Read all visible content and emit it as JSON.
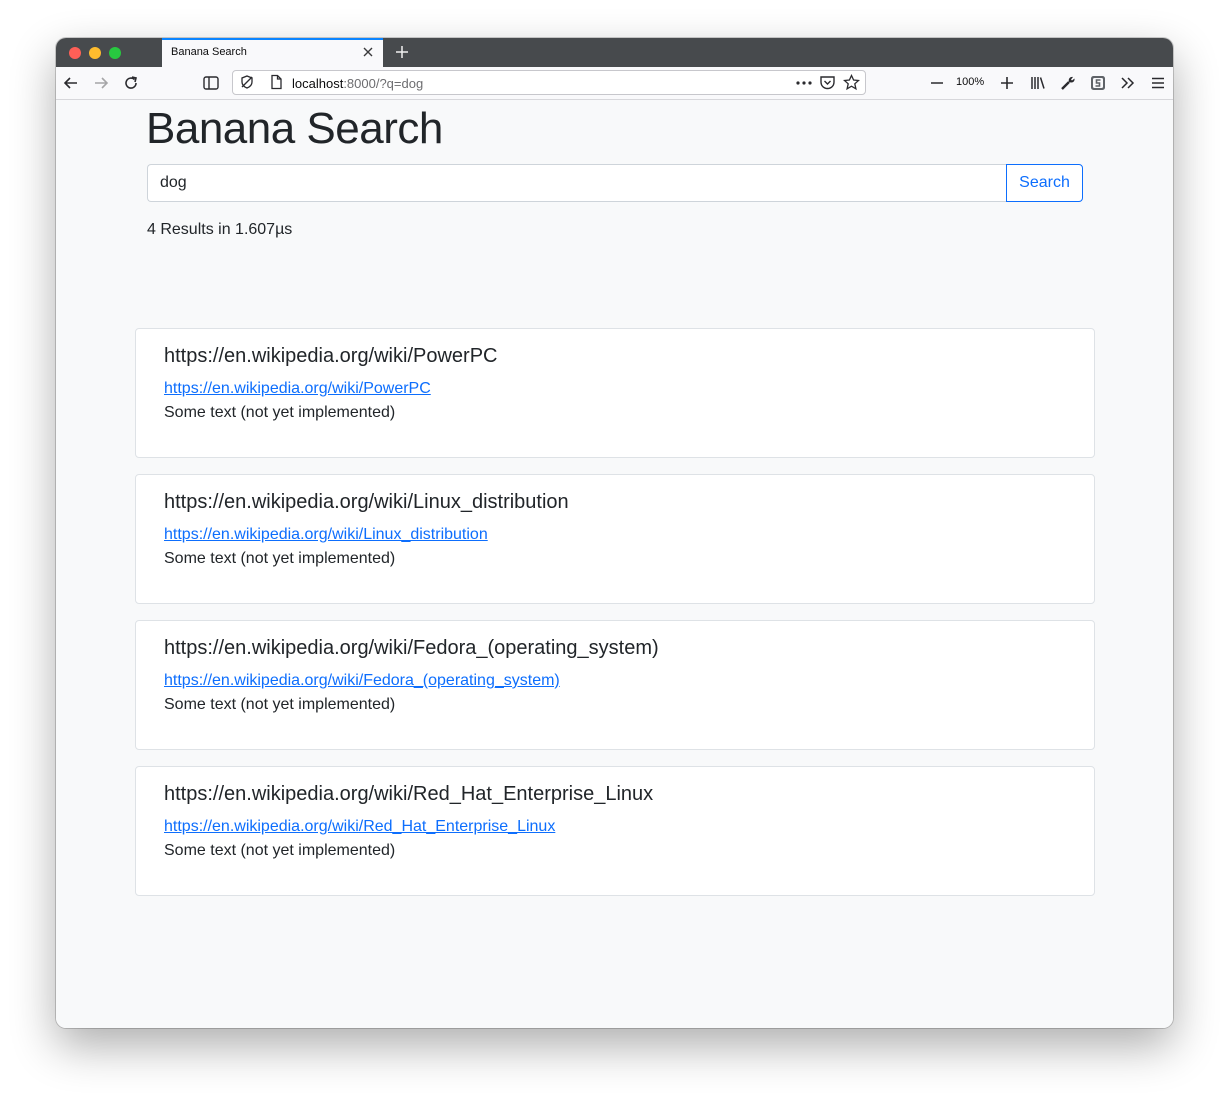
{
  "browser": {
    "tab_title": "Banana Search",
    "url_host": "localhost",
    "url_rest": ":8000/?q=dog",
    "zoom": "100%"
  },
  "page": {
    "title": "Banana Search",
    "search": {
      "value": "dog",
      "button_label": "Search"
    },
    "summary": "4 Results in 1.607µs",
    "results": [
      {
        "title": "https://en.wikipedia.org/wiki/PowerPC",
        "link": "https://en.wikipedia.org/wiki/PowerPC",
        "snippet": "Some text (not yet implemented)"
      },
      {
        "title": "https://en.wikipedia.org/wiki/Linux_distribution",
        "link": "https://en.wikipedia.org/wiki/Linux_distribution",
        "snippet": "Some text (not yet implemented)"
      },
      {
        "title": "https://en.wikipedia.org/wiki/Fedora_(operating_system)",
        "link": "https://en.wikipedia.org/wiki/Fedora_(operating_system)",
        "snippet": "Some text (not yet implemented)"
      },
      {
        "title": "https://en.wikipedia.org/wiki/Red_Hat_Enterprise_Linux",
        "link": "https://en.wikipedia.org/wiki/Red_Hat_Enterprise_Linux",
        "snippet": "Some text (not yet implemented)"
      }
    ]
  },
  "colors": {
    "accent": "#0d6efd",
    "page_background": "#f8f9fa",
    "tabstrip": "#474a4d"
  }
}
